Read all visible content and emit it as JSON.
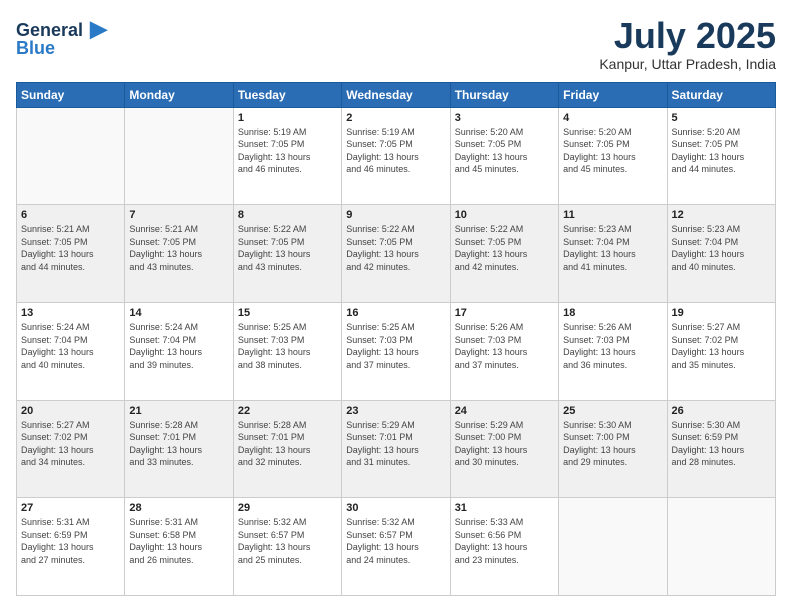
{
  "header": {
    "logo_line1": "General",
    "logo_line2": "Blue",
    "month": "July 2025",
    "location": "Kanpur, Uttar Pradesh, India"
  },
  "weekdays": [
    "Sunday",
    "Monday",
    "Tuesday",
    "Wednesday",
    "Thursday",
    "Friday",
    "Saturday"
  ],
  "rows": [
    {
      "shade": "white",
      "days": [
        {
          "num": "",
          "info": ""
        },
        {
          "num": "",
          "info": ""
        },
        {
          "num": "1",
          "info": "Sunrise: 5:19 AM\nSunset: 7:05 PM\nDaylight: 13 hours\nand 46 minutes."
        },
        {
          "num": "2",
          "info": "Sunrise: 5:19 AM\nSunset: 7:05 PM\nDaylight: 13 hours\nand 46 minutes."
        },
        {
          "num": "3",
          "info": "Sunrise: 5:20 AM\nSunset: 7:05 PM\nDaylight: 13 hours\nand 45 minutes."
        },
        {
          "num": "4",
          "info": "Sunrise: 5:20 AM\nSunset: 7:05 PM\nDaylight: 13 hours\nand 45 minutes."
        },
        {
          "num": "5",
          "info": "Sunrise: 5:20 AM\nSunset: 7:05 PM\nDaylight: 13 hours\nand 44 minutes."
        }
      ]
    },
    {
      "shade": "shaded",
      "days": [
        {
          "num": "6",
          "info": "Sunrise: 5:21 AM\nSunset: 7:05 PM\nDaylight: 13 hours\nand 44 minutes."
        },
        {
          "num": "7",
          "info": "Sunrise: 5:21 AM\nSunset: 7:05 PM\nDaylight: 13 hours\nand 43 minutes."
        },
        {
          "num": "8",
          "info": "Sunrise: 5:22 AM\nSunset: 7:05 PM\nDaylight: 13 hours\nand 43 minutes."
        },
        {
          "num": "9",
          "info": "Sunrise: 5:22 AM\nSunset: 7:05 PM\nDaylight: 13 hours\nand 42 minutes."
        },
        {
          "num": "10",
          "info": "Sunrise: 5:22 AM\nSunset: 7:05 PM\nDaylight: 13 hours\nand 42 minutes."
        },
        {
          "num": "11",
          "info": "Sunrise: 5:23 AM\nSunset: 7:04 PM\nDaylight: 13 hours\nand 41 minutes."
        },
        {
          "num": "12",
          "info": "Sunrise: 5:23 AM\nSunset: 7:04 PM\nDaylight: 13 hours\nand 40 minutes."
        }
      ]
    },
    {
      "shade": "white",
      "days": [
        {
          "num": "13",
          "info": "Sunrise: 5:24 AM\nSunset: 7:04 PM\nDaylight: 13 hours\nand 40 minutes."
        },
        {
          "num": "14",
          "info": "Sunrise: 5:24 AM\nSunset: 7:04 PM\nDaylight: 13 hours\nand 39 minutes."
        },
        {
          "num": "15",
          "info": "Sunrise: 5:25 AM\nSunset: 7:03 PM\nDaylight: 13 hours\nand 38 minutes."
        },
        {
          "num": "16",
          "info": "Sunrise: 5:25 AM\nSunset: 7:03 PM\nDaylight: 13 hours\nand 37 minutes."
        },
        {
          "num": "17",
          "info": "Sunrise: 5:26 AM\nSunset: 7:03 PM\nDaylight: 13 hours\nand 37 minutes."
        },
        {
          "num": "18",
          "info": "Sunrise: 5:26 AM\nSunset: 7:03 PM\nDaylight: 13 hours\nand 36 minutes."
        },
        {
          "num": "19",
          "info": "Sunrise: 5:27 AM\nSunset: 7:02 PM\nDaylight: 13 hours\nand 35 minutes."
        }
      ]
    },
    {
      "shade": "shaded",
      "days": [
        {
          "num": "20",
          "info": "Sunrise: 5:27 AM\nSunset: 7:02 PM\nDaylight: 13 hours\nand 34 minutes."
        },
        {
          "num": "21",
          "info": "Sunrise: 5:28 AM\nSunset: 7:01 PM\nDaylight: 13 hours\nand 33 minutes."
        },
        {
          "num": "22",
          "info": "Sunrise: 5:28 AM\nSunset: 7:01 PM\nDaylight: 13 hours\nand 32 minutes."
        },
        {
          "num": "23",
          "info": "Sunrise: 5:29 AM\nSunset: 7:01 PM\nDaylight: 13 hours\nand 31 minutes."
        },
        {
          "num": "24",
          "info": "Sunrise: 5:29 AM\nSunset: 7:00 PM\nDaylight: 13 hours\nand 30 minutes."
        },
        {
          "num": "25",
          "info": "Sunrise: 5:30 AM\nSunset: 7:00 PM\nDaylight: 13 hours\nand 29 minutes."
        },
        {
          "num": "26",
          "info": "Sunrise: 5:30 AM\nSunset: 6:59 PM\nDaylight: 13 hours\nand 28 minutes."
        }
      ]
    },
    {
      "shade": "white",
      "days": [
        {
          "num": "27",
          "info": "Sunrise: 5:31 AM\nSunset: 6:59 PM\nDaylight: 13 hours\nand 27 minutes."
        },
        {
          "num": "28",
          "info": "Sunrise: 5:31 AM\nSunset: 6:58 PM\nDaylight: 13 hours\nand 26 minutes."
        },
        {
          "num": "29",
          "info": "Sunrise: 5:32 AM\nSunset: 6:57 PM\nDaylight: 13 hours\nand 25 minutes."
        },
        {
          "num": "30",
          "info": "Sunrise: 5:32 AM\nSunset: 6:57 PM\nDaylight: 13 hours\nand 24 minutes."
        },
        {
          "num": "31",
          "info": "Sunrise: 5:33 AM\nSunset: 6:56 PM\nDaylight: 13 hours\nand 23 minutes."
        },
        {
          "num": "",
          "info": ""
        },
        {
          "num": "",
          "info": ""
        }
      ]
    }
  ]
}
